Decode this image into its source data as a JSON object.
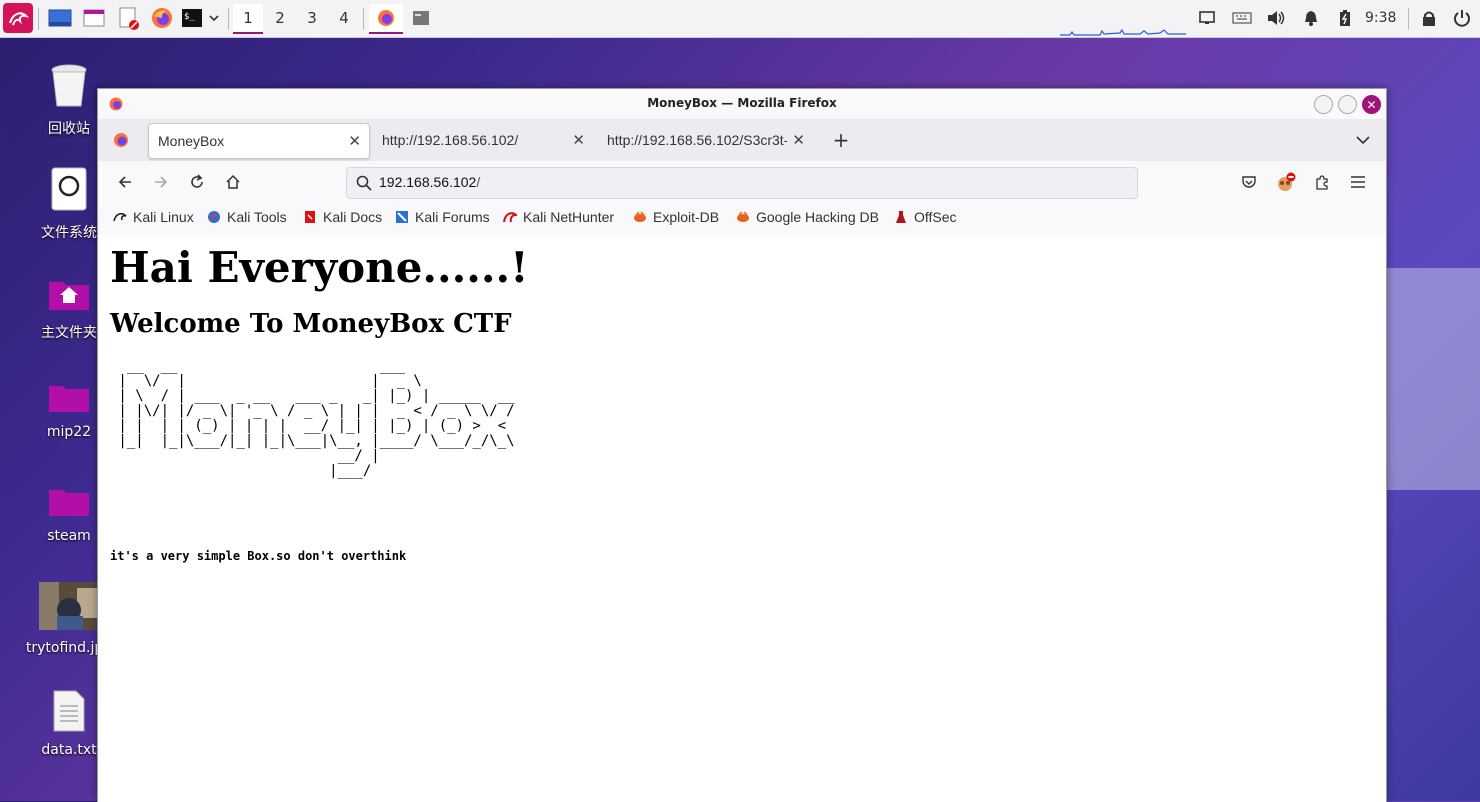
{
  "taskbar": {
    "workspaces": [
      "1",
      "2",
      "3",
      "4"
    ],
    "active_workspace": "1",
    "clock": "9:38",
    "accent_color": "#a0137a"
  },
  "desktop": {
    "icons": [
      {
        "label": "回收站",
        "icon": "trash-icon"
      },
      {
        "label": "文件系统",
        "icon": "filesystem-icon"
      },
      {
        "label": "主文件夹",
        "icon": "home-folder-icon"
      },
      {
        "label": "mip22",
        "icon": "folder-icon"
      },
      {
        "label": "steam",
        "icon": "folder-icon"
      },
      {
        "label": "trytofind.jpg",
        "icon": "image-thumbnail-icon"
      },
      {
        "label": "data.txt",
        "icon": "text-file-icon"
      }
    ]
  },
  "window": {
    "title": "MoneyBox — Mozilla Firefox",
    "tabs": [
      {
        "label": "MoneyBox",
        "selected": true
      },
      {
        "label": "http://192.168.56.102/",
        "selected": false
      },
      {
        "label": "http://192.168.56.102/S3cr3t-",
        "selected": false
      }
    ],
    "url_host": "192.168.56.102",
    "url_path": "/",
    "bookmarks": [
      {
        "label": "Kali Linux",
        "icon": "kali-dragon-icon"
      },
      {
        "label": "Kali Tools",
        "icon": "kali-tools-icon"
      },
      {
        "label": "Kali Docs",
        "icon": "kali-docs-icon"
      },
      {
        "label": "Kali Forums",
        "icon": "kali-forums-icon"
      },
      {
        "label": "Kali NetHunter",
        "icon": "kali-nethunter-icon"
      },
      {
        "label": "Exploit-DB",
        "icon": "exploit-db-icon"
      },
      {
        "label": "Google Hacking DB",
        "icon": "ghdb-icon"
      },
      {
        "label": "OffSec",
        "icon": "offsec-icon"
      }
    ]
  },
  "page": {
    "heading": "Hai Everyone......!",
    "subheading": "Welcome To MoneyBox CTF",
    "ascii_art": "  __  __                        ___\n |  \\/  |                      |  _ \\\n | \\  / | ___  _ __   ___ _   _| |_) | _____  __\n | |\\/| |/ _ \\| '_ \\ / _ \\ | | |  _ < / _ \\ \\/ /\n | |  | | (_) | | | |  __/ |_| | |_) | (_) >  <\n |_|  |_|\\___/|_| |_|\\___|\\__, |____/ \\___/_/\\_\\\n                           __/ |\n                          |___/",
    "tagline": "it's a very simple Box.so don't overthink"
  }
}
